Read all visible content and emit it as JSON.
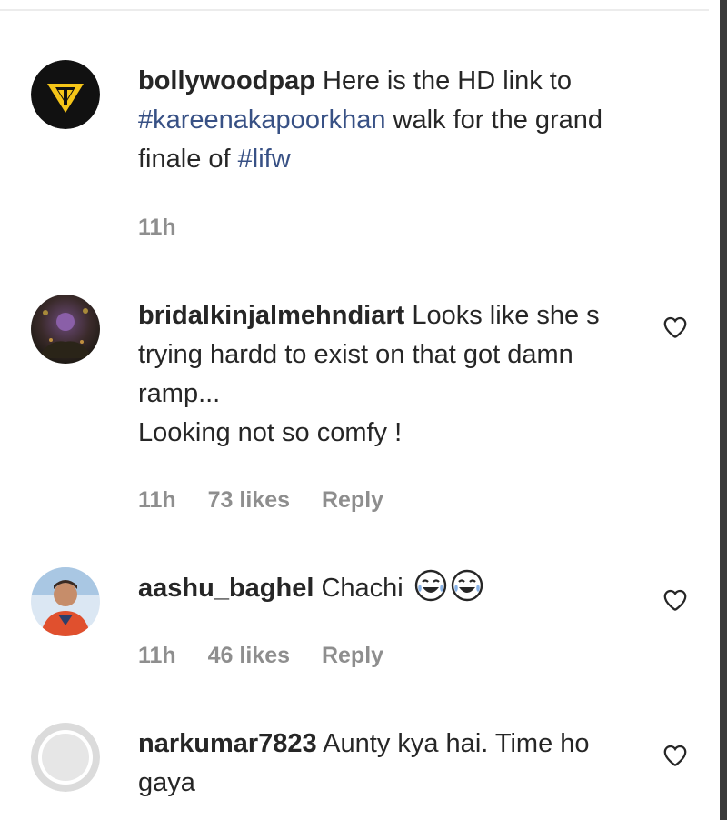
{
  "comments": [
    {
      "username": "bollywoodpap",
      "text_parts": [
        "Here is the HD link to ",
        "#kareenakapoorkhan",
        " walk for the grand finale of ",
        "#lifw"
      ],
      "time": "11h"
    },
    {
      "username": "bridalkinjalmehndiart",
      "text_line1": "Looks like she s trying hardd to exist on that got damn ramp...",
      "text_line2": "Looking not so comfy !",
      "time": "11h",
      "likes": "73 likes",
      "reply": "Reply"
    },
    {
      "username": "aashu_baghel",
      "text": "Chachi",
      "emoji": "face-with-tears-of-joy-icon",
      "time": "11h",
      "likes": "46 likes",
      "reply": "Reply"
    },
    {
      "username": "narkumar7823",
      "text": "Aunty kya hai. Time ho gaya"
    }
  ],
  "colors": {
    "text": "#262626",
    "hashtag": "#385185",
    "meta": "#8e8e8e",
    "logo_yellow": "#f5c518"
  }
}
